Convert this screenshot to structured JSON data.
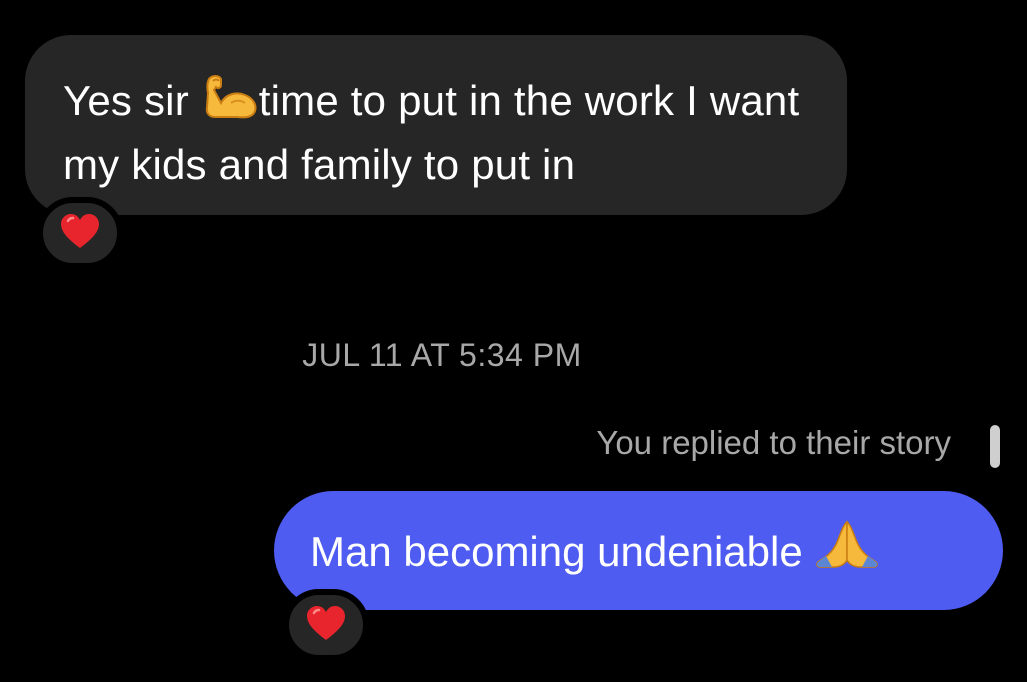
{
  "thread": {
    "incoming_message": {
      "text_before_emoji": "Yes sir ",
      "emoji": "flexed-biceps",
      "text_after_emoji": "time to put in the work I want my kids and family to put in",
      "reaction": "heart"
    },
    "timestamp": "JUL 11 AT 5:34 PM",
    "story_reply_label": "You replied to their story",
    "outgoing_message": {
      "text": "Man becoming undeniable ",
      "emoji": "folded-hands",
      "reaction": "heart"
    }
  },
  "colors": {
    "background": "#000000",
    "incoming_bubble": "#262626",
    "outgoing_bubble": "#4f5cf2",
    "secondary_text": "#a8a8a8",
    "heart": "#e8252d"
  }
}
